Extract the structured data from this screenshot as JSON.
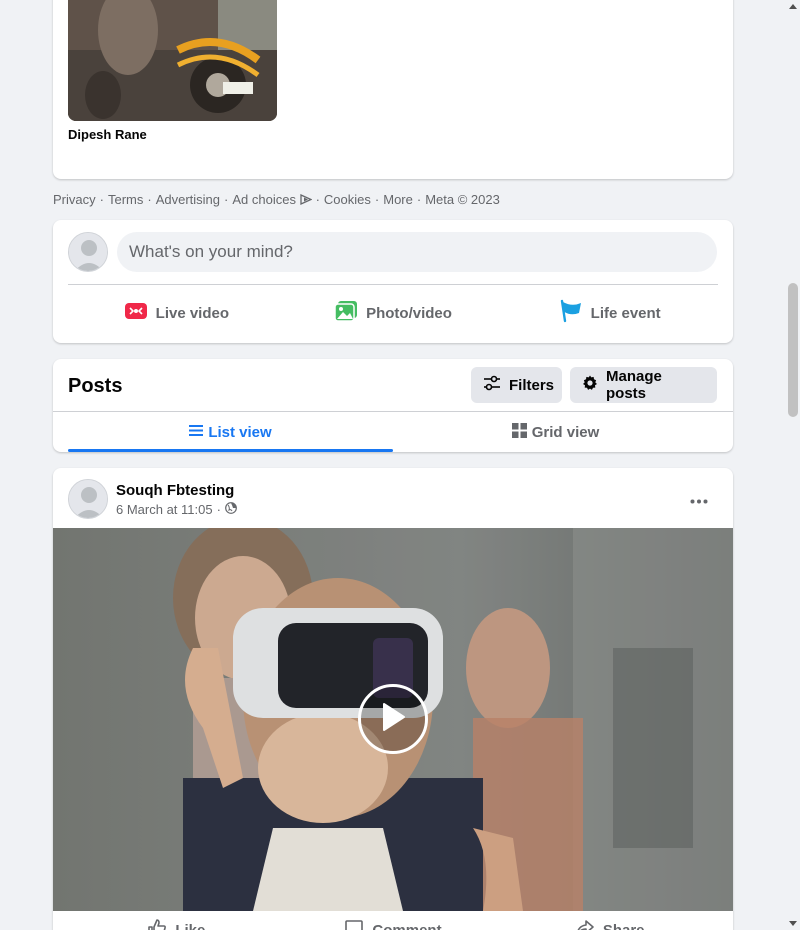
{
  "friends": {
    "items": [
      {
        "name": "Dipesh Rane"
      }
    ]
  },
  "footer": {
    "links": [
      "Privacy",
      "Terms",
      "Advertising",
      "Ad choices",
      "Cookies",
      "More"
    ],
    "copyright": "Meta © 2023"
  },
  "composer": {
    "placeholder": "What's on your mind?",
    "actions": {
      "live": "Live video",
      "photo": "Photo/video",
      "life": "Life event"
    }
  },
  "posts": {
    "title": "Posts",
    "filters_label": "Filters",
    "manage_label": "Manage posts",
    "tabs": {
      "list": "List view",
      "grid": "Grid view"
    }
  },
  "post": {
    "author": "Souqh Fbtesting",
    "timestamp": "6 March at 11:05",
    "privacy_icon": "globe-icon",
    "actions": {
      "like": "Like",
      "comment": "Comment",
      "share": "Share"
    }
  },
  "colors": {
    "accent": "#1877f2",
    "live_red": "#f02849",
    "photo_green": "#45bd62",
    "life_blue": "#1ba0e1"
  }
}
